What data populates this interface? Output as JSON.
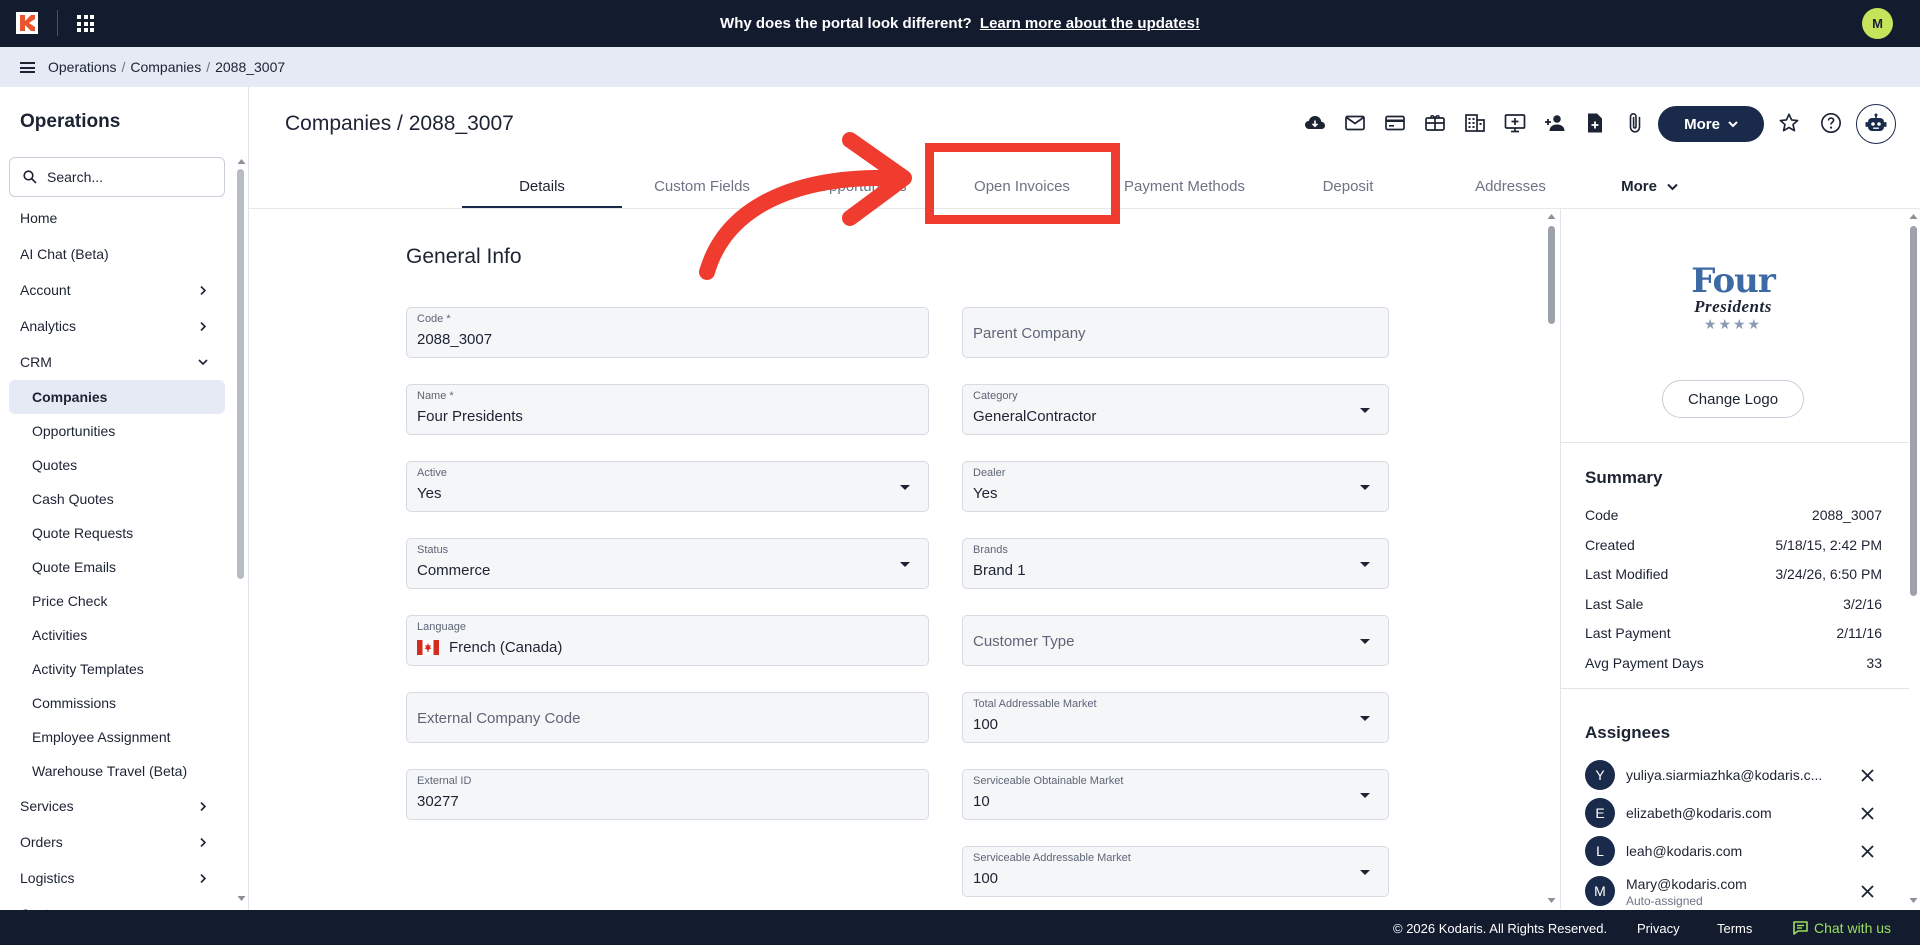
{
  "topbar": {
    "announcement_text": "Why does the portal look different?",
    "announcement_link": "Learn more about the updates!",
    "user_initial": "M"
  },
  "breadcrumb": [
    "Operations",
    "Companies",
    "2088_3007"
  ],
  "sidebar": {
    "title": "Operations",
    "search_placeholder": "Search...",
    "items": [
      {
        "label": "Home",
        "kind": "top"
      },
      {
        "label": "AI Chat (Beta)",
        "kind": "top"
      },
      {
        "label": "Account",
        "kind": "top",
        "chevron": "right"
      },
      {
        "label": "Analytics",
        "kind": "top",
        "chevron": "right"
      },
      {
        "label": "CRM",
        "kind": "top",
        "chevron": "down"
      },
      {
        "label": "Companies",
        "kind": "sub",
        "active": true
      },
      {
        "label": "Opportunities",
        "kind": "sub"
      },
      {
        "label": "Quotes",
        "kind": "sub"
      },
      {
        "label": "Cash Quotes",
        "kind": "sub"
      },
      {
        "label": "Quote Requests",
        "kind": "sub"
      },
      {
        "label": "Quote Emails",
        "kind": "sub"
      },
      {
        "label": "Price Check",
        "kind": "sub"
      },
      {
        "label": "Activities",
        "kind": "sub"
      },
      {
        "label": "Activity Templates",
        "kind": "sub"
      },
      {
        "label": "Commissions",
        "kind": "sub"
      },
      {
        "label": "Employee Assignment",
        "kind": "sub"
      },
      {
        "label": "Warehouse Travel (Beta)",
        "kind": "sub"
      },
      {
        "label": "Services",
        "kind": "top",
        "chevron": "right"
      },
      {
        "label": "Orders",
        "kind": "top",
        "chevron": "right"
      },
      {
        "label": "Logistics",
        "kind": "top",
        "chevron": "right"
      },
      {
        "label": "Customers",
        "kind": "top",
        "chevron": "right"
      }
    ]
  },
  "header": {
    "title": "Companies / 2088_3007",
    "more_label": "More",
    "action_icons": [
      "cloud-download-icon",
      "mail-icon",
      "credit-card-icon",
      "gift-card-icon",
      "building-icon",
      "add-to-screen-icon",
      "add-person-icon",
      "add-document-icon",
      "attachment-icon"
    ]
  },
  "tabs": [
    {
      "label": "Details",
      "active": true
    },
    {
      "label": "Custom Fields"
    },
    {
      "label": "Opportunities"
    },
    {
      "label": "Open Invoices"
    },
    {
      "label": "Payment Methods"
    },
    {
      "label": "Deposit"
    },
    {
      "label": "Addresses"
    },
    {
      "label": "More",
      "more": true
    }
  ],
  "form": {
    "section_title": "General Info",
    "fields": {
      "code": {
        "label": "Code *",
        "value": "2088_3007"
      },
      "parent_company": {
        "placeholder": "Parent Company"
      },
      "name": {
        "label": "Name *",
        "value": "Four Presidents"
      },
      "category": {
        "label": "Category",
        "value": "GeneralContractor"
      },
      "active": {
        "label": "Active",
        "value": "Yes"
      },
      "dealer": {
        "label": "Dealer",
        "value": "Yes"
      },
      "status": {
        "label": "Status",
        "value": "Commerce"
      },
      "brands": {
        "label": "Brands",
        "value": "Brand 1"
      },
      "language": {
        "label": "Language",
        "value": "French (Canada)"
      },
      "customer_type": {
        "placeholder": "Customer Type"
      },
      "external_company_code": {
        "placeholder": "External Company Code"
      },
      "total_addressable_market": {
        "label": "Total Addressable Market",
        "value": "100"
      },
      "external_id": {
        "label": "External ID",
        "value": "30277"
      },
      "serviceable_obtainable_market": {
        "label": "Serviceable Obtainable Market",
        "value": "10"
      },
      "serviceable_addressable_market": {
        "label": "Serviceable Addressable Market",
        "value": "100"
      }
    }
  },
  "company_logo": {
    "line1": "Four",
    "line2": "Presidents",
    "stars": "★★★★"
  },
  "right_panel": {
    "change_logo_label": "Change Logo",
    "summary_title": "Summary",
    "summary": [
      {
        "key": "Code",
        "value": "2088_3007"
      },
      {
        "key": "Created",
        "value": "5/18/15, 2:42 PM"
      },
      {
        "key": "Last Modified",
        "value": "3/24/26, 6:50 PM"
      },
      {
        "key": "Last Sale",
        "value": "3/2/16"
      },
      {
        "key": "Last Payment",
        "value": "2/11/16"
      },
      {
        "key": "Avg Payment Days",
        "value": "33"
      }
    ],
    "assignees_title": "Assignees",
    "assignees": [
      {
        "initial": "Y",
        "email": "yuliya.siarmiazhka@kodaris.c..."
      },
      {
        "initial": "E",
        "email": "elizabeth@kodaris.com"
      },
      {
        "initial": "L",
        "email": "leah@kodaris.com"
      },
      {
        "initial": "M",
        "email": "Mary@kodaris.com",
        "note": "Auto-assigned"
      }
    ]
  },
  "footer": {
    "copyright": "© 2026 Kodaris. All Rights Reserved.",
    "privacy": "Privacy",
    "terms": "Terms",
    "chat": "Chat with us"
  },
  "colors": {
    "topbar": "#131b2e",
    "accent_navy": "#1a2a4a",
    "annotation_red": "#f03c2e",
    "chat_green": "#9be05c"
  }
}
